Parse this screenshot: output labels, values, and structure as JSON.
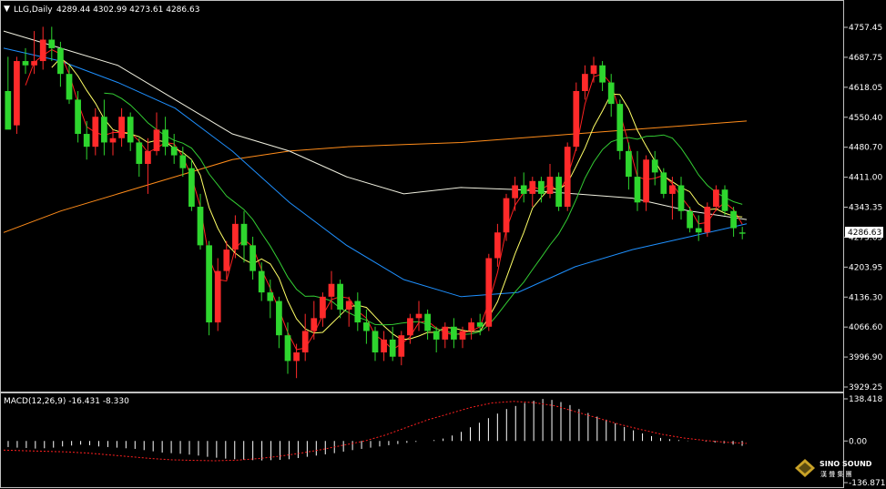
{
  "colors": {
    "background": "#000000",
    "frame": "#c0c0c0",
    "up_candle": "#ff2a2a",
    "down_candle": "#2ed62e",
    "ma_fast": "#ff2020",
    "ma_yellow": "#ffff66",
    "ma_green": "#33cc33",
    "ma_blue": "#1e90ff",
    "ma_white": "#f0f0e0",
    "ma_orange": "#ff8c1a",
    "macd_hist": "#ffffff",
    "macd_signal": "#ff2020",
    "price_tag_bg": "#ffffff",
    "price_tag_text": "#000000"
  },
  "header": {
    "symbol_label": "LLG,Daily",
    "ohlc": "4289.44 4302.99 4273.61 4286.63",
    "menu_icon": "triangle-down-icon"
  },
  "price_axis": {
    "labels": [
      "4757.45",
      "4687.75",
      "4618.05",
      "4550.40",
      "4480.70",
      "4411.00",
      "4343.35",
      "4273.65",
      "4203.95",
      "4136.30",
      "4066.60",
      "3996.90",
      "3929.25"
    ],
    "current_price": "4286.63"
  },
  "macd": {
    "label": "MACD(12,26,9) -16.431 -8.330",
    "axis_labels": [
      "138.418",
      "0.00",
      "-136.871"
    ]
  },
  "logo": {
    "name": "SINO SOUND",
    "subtitle": "漢 聲 集 團"
  },
  "chart_data": {
    "type": "candlestick",
    "timeframe": "Daily",
    "symbol": "LLG",
    "ylim": [
      3929.25,
      4790
    ],
    "macd_ylim": [
      -136.871,
      138.418
    ],
    "grid": false,
    "candles": [
      [
        4620,
        4700,
        4580,
        4530
      ],
      [
        4540,
        4700,
        4520,
        4690
      ],
      [
        4690,
        4720,
        4660,
        4680
      ],
      [
        4680,
        4760,
        4660,
        4690
      ],
      [
        4690,
        4770,
        4670,
        4740
      ],
      [
        4740,
        4770,
        4690,
        4720
      ],
      [
        4720,
        4735,
        4630,
        4660
      ],
      [
        4660,
        4680,
        4590,
        4600
      ],
      [
        4600,
        4620,
        4500,
        4520
      ],
      [
        4520,
        4550,
        4460,
        4490
      ],
      [
        4490,
        4580,
        4470,
        4560
      ],
      [
        4560,
        4600,
        4470,
        4500
      ],
      [
        4500,
        4530,
        4470,
        4510
      ],
      [
        4510,
        4580,
        4490,
        4560
      ],
      [
        4560,
        4570,
        4480,
        4500
      ],
      [
        4500,
        4510,
        4420,
        4450
      ],
      [
        4450,
        4510,
        4380,
        4480
      ],
      [
        4480,
        4570,
        4470,
        4530
      ],
      [
        4530,
        4560,
        4470,
        4490
      ],
      [
        4490,
        4520,
        4450,
        4470
      ],
      [
        4470,
        4490,
        4420,
        4440
      ],
      [
        4440,
        4460,
        4340,
        4350
      ],
      [
        4350,
        4380,
        4250,
        4260
      ],
      [
        4260,
        4270,
        4050,
        4080
      ],
      [
        4080,
        4230,
        4060,
        4200
      ],
      [
        4200,
        4270,
        4180,
        4250
      ],
      [
        4250,
        4330,
        4230,
        4310
      ],
      [
        4310,
        4340,
        4220,
        4260
      ],
      [
        4260,
        4280,
        4180,
        4200
      ],
      [
        4200,
        4220,
        4130,
        4150
      ],
      [
        4150,
        4180,
        4090,
        4130
      ],
      [
        4130,
        4140,
        4020,
        4050
      ],
      [
        4050,
        4080,
        3960,
        3990
      ],
      [
        3990,
        4030,
        3950,
        4010
      ],
      [
        4010,
        4100,
        3990,
        4060
      ],
      [
        4060,
        4130,
        4040,
        4090
      ],
      [
        4090,
        4150,
        4070,
        4140
      ],
      [
        4140,
        4200,
        4110,
        4170
      ],
      [
        4170,
        4180,
        4090,
        4110
      ],
      [
        4110,
        4140,
        4070,
        4130
      ],
      [
        4130,
        4150,
        4060,
        4080
      ],
      [
        4080,
        4110,
        4030,
        4060
      ],
      [
        4060,
        4070,
        3990,
        4010
      ],
      [
        4010,
        4060,
        3990,
        4040
      ],
      [
        4040,
        4070,
        3990,
        4000
      ],
      [
        4000,
        4060,
        3980,
        4050
      ],
      [
        4050,
        4100,
        4030,
        4090
      ],
      [
        4090,
        4130,
        4060,
        4100
      ],
      [
        4100,
        4110,
        4040,
        4060
      ],
      [
        4060,
        4070,
        4010,
        4040
      ],
      [
        4040,
        4080,
        4020,
        4070
      ],
      [
        4070,
        4090,
        4020,
        4040
      ],
      [
        4040,
        4070,
        4020,
        4060
      ],
      [
        4060,
        4090,
        4040,
        4080
      ],
      [
        4080,
        4100,
        4050,
        4070
      ],
      [
        4070,
        4240,
        4060,
        4230
      ],
      [
        4230,
        4310,
        4210,
        4290
      ],
      [
        4290,
        4380,
        4270,
        4370
      ],
      [
        4370,
        4420,
        4340,
        4400
      ],
      [
        4400,
        4430,
        4360,
        4380
      ],
      [
        4380,
        4420,
        4350,
        4410
      ],
      [
        4410,
        4420,
        4360,
        4380
      ],
      [
        4380,
        4450,
        4370,
        4420
      ],
      [
        4420,
        4430,
        4340,
        4350
      ],
      [
        4350,
        4500,
        4340,
        4490
      ],
      [
        4490,
        4640,
        4480,
        4620
      ],
      [
        4620,
        4680,
        4600,
        4660
      ],
      [
        4660,
        4700,
        4640,
        4680
      ],
      [
        4680,
        4690,
        4620,
        4640
      ],
      [
        4640,
        4660,
        4560,
        4590
      ],
      [
        4590,
        4600,
        4460,
        4480
      ],
      [
        4480,
        4500,
        4390,
        4420
      ],
      [
        4420,
        4480,
        4340,
        4360
      ],
      [
        4360,
        4470,
        4340,
        4460
      ],
      [
        4460,
        4480,
        4400,
        4430
      ],
      [
        4430,
        4440,
        4370,
        4380
      ],
      [
        4380,
        4420,
        4320,
        4400
      ],
      [
        4400,
        4420,
        4320,
        4340
      ],
      [
        4340,
        4350,
        4290,
        4300
      ],
      [
        4300,
        4330,
        4270,
        4290
      ],
      [
        4290,
        4360,
        4280,
        4350
      ],
      [
        4350,
        4400,
        4340,
        4390
      ],
      [
        4390,
        4400,
        4330,
        4340
      ],
      [
        4340,
        4350,
        4280,
        4300
      ],
      [
        4290,
        4303,
        4274,
        4287
      ]
    ],
    "ma_lines": [
      {
        "color": "ma_orange",
        "values": [
          4290,
          4340,
          4380,
          4420,
          4460,
          4480,
          4490,
          4495,
          4500,
          4510,
          4520,
          4530,
          4540,
          4550
        ]
      },
      {
        "color": "ma_white",
        "values": [
          4760,
          4720,
          4680,
          4600,
          4520,
          4480,
          4420,
          4380,
          4395,
          4390,
          4380,
          4370,
          4340,
          4320
        ]
      },
      {
        "color": "ma_blue",
        "values": [
          4720,
          4690,
          4640,
          4580,
          4480,
          4360,
          4260,
          4180,
          4140,
          4150,
          4210,
          4250,
          4280,
          4310
        ]
      }
    ],
    "macd_hist": [
      -20,
      -22,
      -23,
      -25,
      -24,
      -22,
      -18,
      -15,
      -12,
      -14,
      -18,
      -20,
      -22,
      -24,
      -26,
      -30,
      -34,
      -38,
      -40,
      -42,
      -45,
      -48,
      -52,
      -55,
      -58,
      -60,
      -62,
      -63,
      -64,
      -63,
      -62,
      -60,
      -56,
      -52,
      -48,
      -44,
      -40,
      -35,
      -30,
      -26,
      -22,
      -18,
      -14,
      -10,
      -6,
      -3,
      0,
      3,
      8,
      18,
      30,
      45,
      60,
      75,
      90,
      105,
      115,
      125,
      132,
      138,
      135,
      128,
      118,
      105,
      92,
      80,
      70,
      58,
      46,
      35,
      25,
      16,
      10,
      6,
      3,
      1,
      0,
      -2,
      -5,
      -8,
      -12,
      -16
    ],
    "macd_signal": [
      -30,
      -32,
      -34,
      -36,
      -40,
      -46,
      -52,
      -58,
      -62,
      -64,
      -65,
      -63,
      -58,
      -50,
      -40,
      -28,
      -14,
      0,
      20,
      45,
      70,
      90,
      110,
      125,
      130,
      126,
      115,
      95,
      75,
      55,
      38,
      22,
      10,
      2,
      -4,
      -8
    ]
  }
}
